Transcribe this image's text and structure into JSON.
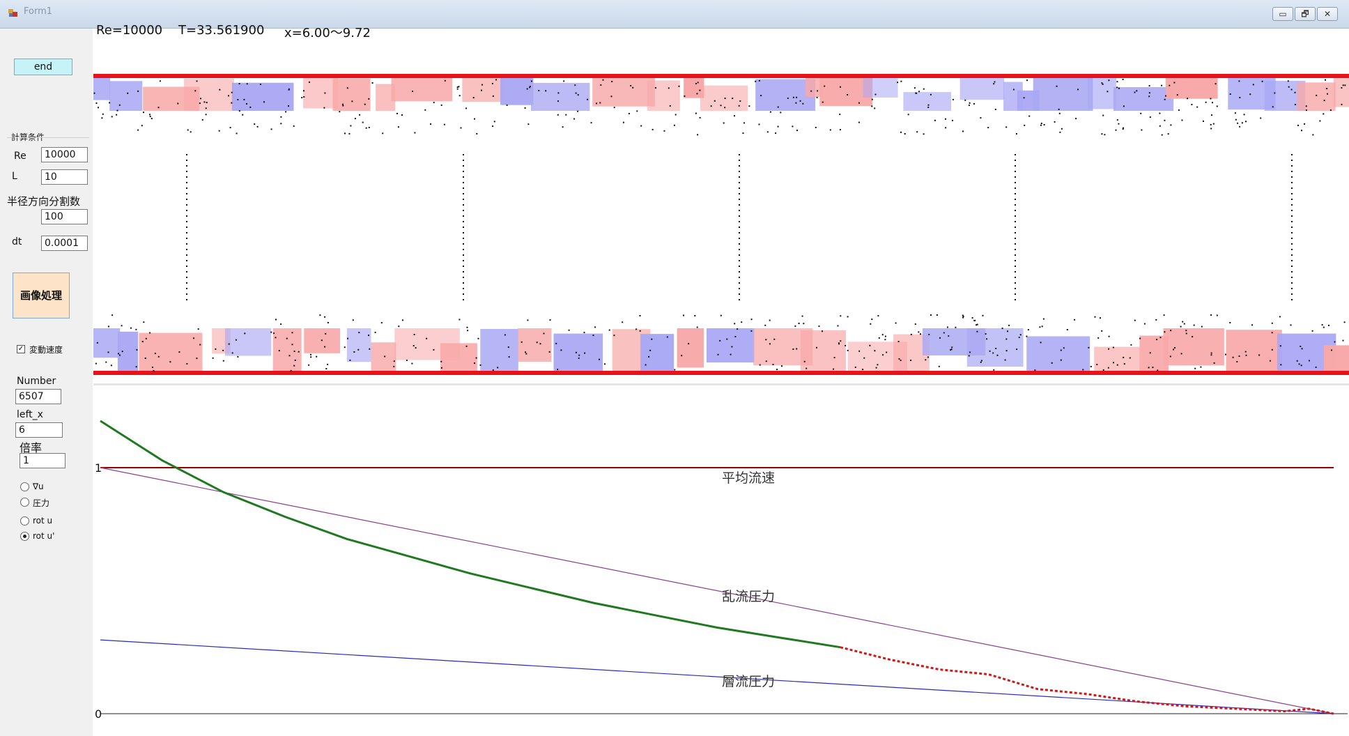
{
  "window": {
    "title": "Form1",
    "controls": {
      "minimize": "▭",
      "restore": "🗗",
      "close": "✕"
    }
  },
  "sidebar": {
    "end_label": "end",
    "conditions_group": "計算条件",
    "re_label": "Re",
    "re_value": "10000",
    "l_label": "L",
    "l_value": "10",
    "radial_div_label": "半径方向分割数",
    "radial_div_value": "100",
    "dt_label": "dt",
    "dt_value": "0.0001",
    "image_button_label": "画像処理",
    "fluct_velocity_label": "変動速度",
    "fluct_velocity_checked": true,
    "number_label": "Number",
    "number_value": "6507",
    "left_x_label": "left_x",
    "left_x_value": "6",
    "scale_label": "倍率",
    "scale_value": "1",
    "radios": [
      {
        "label": "∇u",
        "checked": false
      },
      {
        "label": "圧力",
        "checked": false
      },
      {
        "label": "rot u",
        "checked": false
      },
      {
        "label": "rot u'",
        "checked": true
      }
    ]
  },
  "status": {
    "re": "Re=10000",
    "t": "T=33.561900",
    "x_range": "x=6.00～9.72"
  },
  "colors": {
    "wall": "#e8121a",
    "vort_pos": "#f8a8a8",
    "vort_neg": "#a9a8f4",
    "mean_velocity": "#9b0000",
    "turbulent_pressure": "#8c3f8c",
    "laminar_pressure": "#2a2ab8",
    "pressure_curve": "#1f7a1f",
    "pressure_curve_unstable": "#d41616",
    "button_end": "#c6f3f8",
    "button_image": "#fde3c8"
  },
  "chart_data": {
    "type": "line",
    "title": "",
    "xlabel": "",
    "ylabel": "",
    "yticks": [
      "1",
      "0"
    ],
    "ylim": [
      0,
      1.1
    ],
    "xlim": [
      0,
      10
    ],
    "series": [
      {
        "name": "平均流速",
        "x": [
          0,
          10
        ],
        "y": [
          1.0,
          1.0
        ]
      },
      {
        "name": "乱流圧力",
        "x": [
          0,
          10
        ],
        "y": [
          1.0,
          0.0
        ]
      },
      {
        "name": "層流圧力",
        "x": [
          0,
          10
        ],
        "y": [
          0.3,
          0.0
        ]
      },
      {
        "x": [
          0,
          0.5,
          1.0,
          1.5,
          2.0,
          2.5,
          3.0,
          3.5,
          4.0,
          4.5,
          5.0,
          5.5,
          6.0
        ],
        "y": [
          1.19,
          1.03,
          0.9,
          0.8,
          0.71,
          0.64,
          0.57,
          0.51,
          0.45,
          0.4,
          0.35,
          0.31,
          0.27
        ]
      },
      {
        "x": [
          6.0,
          6.4,
          6.8,
          7.2,
          7.6,
          8.0,
          8.4,
          8.8,
          9.2,
          9.6,
          9.8,
          10.0
        ],
        "y": [
          0.27,
          0.22,
          0.18,
          0.16,
          0.1,
          0.08,
          0.05,
          0.03,
          0.02,
          0.01,
          0.02,
          0.0
        ]
      }
    ]
  }
}
